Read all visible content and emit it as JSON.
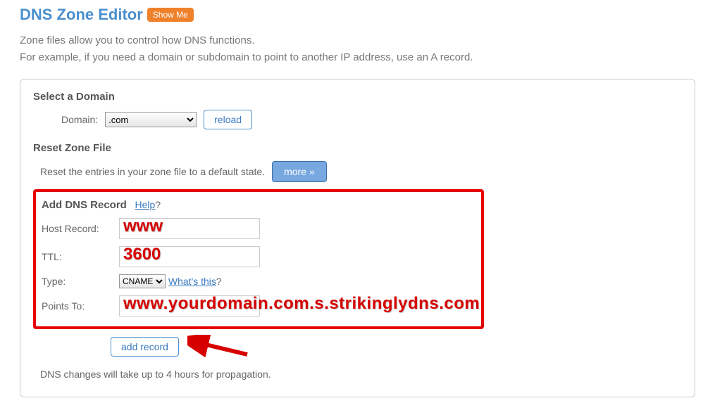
{
  "header": {
    "title": "DNS Zone Editor",
    "show_me_label": "Show Me"
  },
  "intro": {
    "line1": "Zone files allow you to control how DNS functions.",
    "line2": "For example, if you need a domain or subdomain to point to another IP address, use an A record."
  },
  "select_domain": {
    "heading": "Select a Domain",
    "label": "Domain:",
    "selected": ".com",
    "reload_label": "reload"
  },
  "reset_zone": {
    "heading": "Reset Zone File",
    "description": "Reset the entries in your zone file to a default state.",
    "more_label": "more »"
  },
  "add_record": {
    "heading": "Add DNS Record",
    "help_label": "Help",
    "help_q": "?",
    "host_record_label": "Host Record:",
    "host_record_value": "",
    "ttl_label": "TTL:",
    "ttl_value": "",
    "type_label": "Type:",
    "type_selected": "CNAME",
    "whats_this_label": "What's this",
    "whats_this_q": "?",
    "points_to_label": "Points To:",
    "points_to_value": "",
    "submit_label": "add record"
  },
  "overlays": {
    "www": "www",
    "ttl": "3600",
    "points_to": "www.yourdomain.com.s.strikinglydns.com"
  },
  "footer_note": "DNS changes will take up to 4 hours for propagation.",
  "colors": {
    "accent_blue": "#4a8fce",
    "accent_orange": "#f0812b",
    "highlight_red": "#e60000"
  }
}
